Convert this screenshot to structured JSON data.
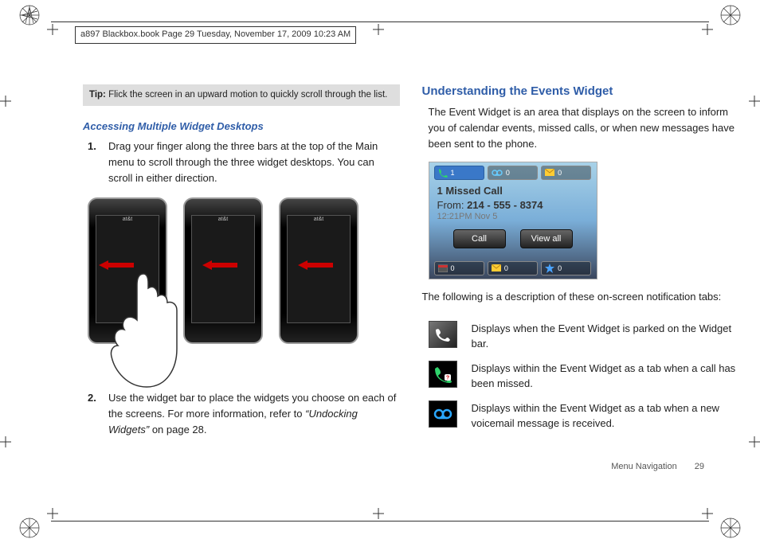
{
  "header_line": "a897 Blackbox.book  Page 29  Tuesday, November 17, 2009  10:23 AM",
  "left": {
    "tip_label": "Tip:",
    "tip_text": "Flick the screen in an upward motion to quickly scroll through the list.",
    "heading": "Accessing Multiple Widget Desktops",
    "step1_num": "1.",
    "step1_txt": "Drag your finger along the three bars at the top of the Main menu to scroll through the three widget desktops. You can scroll in either direction.",
    "step2_num": "2.",
    "step2_txt_a": "Use the widget bar to place the widgets you choose on each of the screens. For more information, refer to ",
    "step2_xref": "“Undocking Widgets”",
    "step2_txt_b": "  on page 28.",
    "carrier": "at&t"
  },
  "right": {
    "heading": "Understanding the Events Widget",
    "intro": "The Event Widget is an area that displays on the screen to inform you of calendar events, missed calls, or when new messages have been sent to the phone.",
    "widget": {
      "tab_missed_n": "1",
      "tab_vm_n": "0",
      "tab_msg_n": "0",
      "title": "1 Missed Call",
      "from_label": "From:",
      "from_num": "214 - 555 - 8374",
      "time": "12:21PM Nov 5",
      "btn_call": "Call",
      "btn_viewall": "View all",
      "bot_a": "0",
      "bot_b": "0",
      "bot_c": "0"
    },
    "after_fig": "The following is a description of these on-screen notification tabs:",
    "row1": "Displays when the Event Widget is parked on the Widget bar.",
    "row2": "Displays within the Event Widget as a tab when a call has been missed.",
    "row3": "Displays within the Event Widget as a tab when a new voicemail message is received."
  },
  "footer_section": "Menu Navigation",
  "footer_page": "29"
}
